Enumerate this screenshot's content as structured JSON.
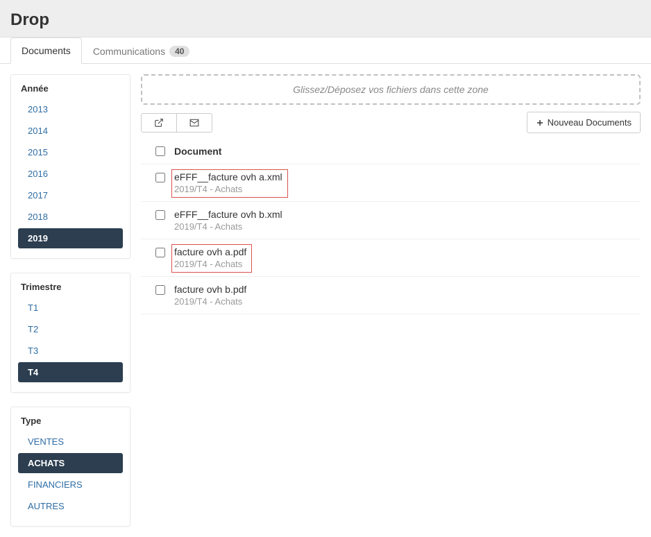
{
  "header": {
    "title": "Drop"
  },
  "tabs": [
    {
      "label": "Documents",
      "active": true
    },
    {
      "label": "Communications",
      "badge": "40",
      "active": false
    }
  ],
  "sidebar": {
    "annee": {
      "title": "Année",
      "items": [
        {
          "label": "2013",
          "active": false
        },
        {
          "label": "2014",
          "active": false
        },
        {
          "label": "2015",
          "active": false
        },
        {
          "label": "2016",
          "active": false
        },
        {
          "label": "2017",
          "active": false
        },
        {
          "label": "2018",
          "active": false
        },
        {
          "label": "2019",
          "active": true
        }
      ]
    },
    "trimestre": {
      "title": "Trimestre",
      "items": [
        {
          "label": "T1",
          "active": false
        },
        {
          "label": "T2",
          "active": false
        },
        {
          "label": "T3",
          "active": false
        },
        {
          "label": "T4",
          "active": true
        }
      ]
    },
    "type": {
      "title": "Type",
      "items": [
        {
          "label": "VENTES",
          "active": false
        },
        {
          "label": "ACHATS",
          "active": true
        },
        {
          "label": "FINANCIERS",
          "active": false
        },
        {
          "label": "AUTRES",
          "active": false
        }
      ]
    }
  },
  "dropzone": {
    "text": "Glissez/Déposez vos fichiers dans cette zone"
  },
  "toolbar": {
    "new_button": "Nouveau Documents"
  },
  "table": {
    "header": "Document",
    "rows": [
      {
        "name": "eFFF__facture ovh a.xml",
        "sub": "2019/T4 - Achats",
        "highlighted": true
      },
      {
        "name": "eFFF__facture ovh b.xml",
        "sub": "2019/T4 - Achats",
        "highlighted": false
      },
      {
        "name": "facture ovh a.pdf",
        "sub": "2019/T4 - Achats",
        "highlighted": true
      },
      {
        "name": "facture ovh b.pdf",
        "sub": "2019/T4 - Achats",
        "highlighted": false
      }
    ]
  }
}
